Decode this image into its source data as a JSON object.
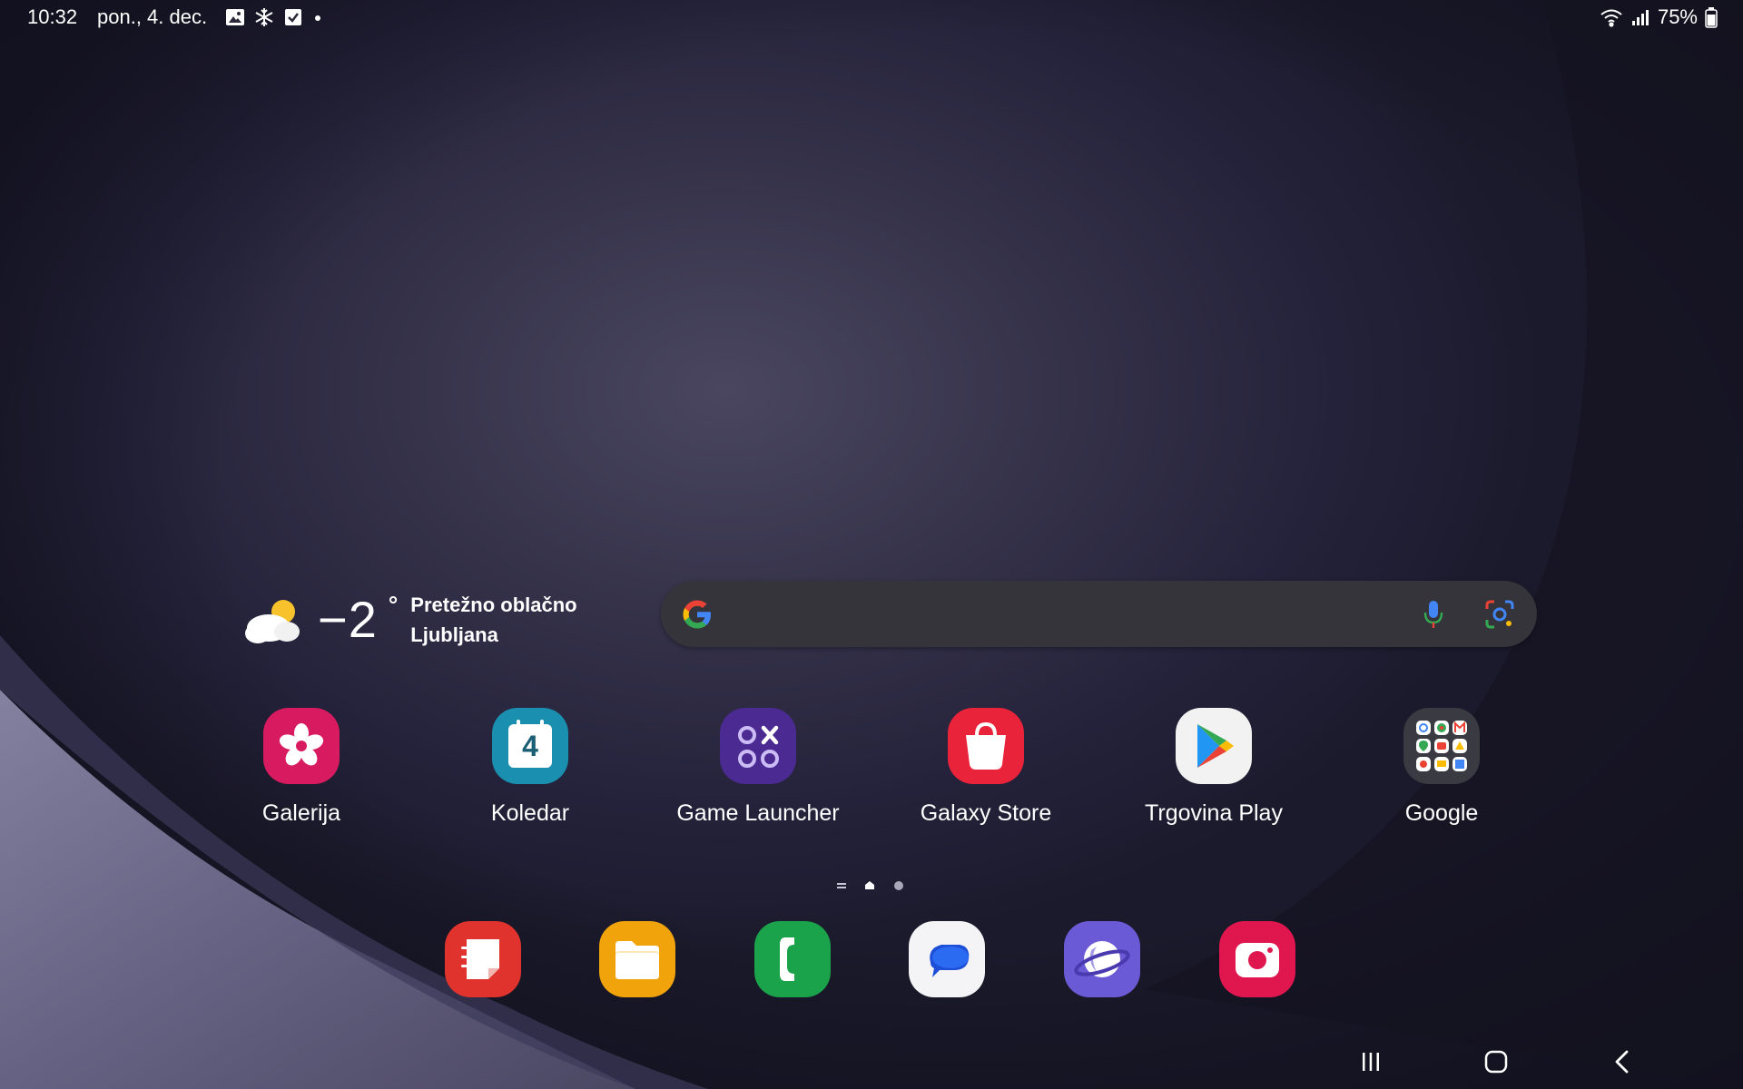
{
  "status_bar": {
    "time": "10:32",
    "date": "pon., 4. dec.",
    "notification_icons": [
      "gallery-icon",
      "snowflake-icon",
      "checkbox-icon",
      "dot-icon"
    ],
    "battery_percent": "75%",
    "icons_right": [
      "wifi-icon",
      "signal-icon",
      "battery-icon"
    ]
  },
  "weather": {
    "temperature": "−2",
    "unit": "°",
    "condition": "Pretežno oblačno",
    "location": "Ljubljana",
    "icon": "partly-cloudy-icon"
  },
  "search_bar": {
    "icons": [
      "google-g-icon",
      "microphone-icon",
      "google-lens-icon"
    ]
  },
  "apps": [
    {
      "label": "Galerija",
      "icon": "gallery-flower-icon",
      "color": "#d81b60"
    },
    {
      "label": "Koledar",
      "icon": "calendar-icon",
      "color": "#1a8fb0",
      "calendar_day": "4"
    },
    {
      "label": "Game Launcher",
      "icon": "game-launcher-icon",
      "color": "#4b2a91"
    },
    {
      "label": "Galaxy Store",
      "icon": "shopping-bag-icon",
      "color": "#e8233a"
    },
    {
      "label": "Trgovina Play",
      "icon": "google-play-icon",
      "color": "#f2f2f2"
    },
    {
      "label": "Google",
      "icon": "google-folder-icon",
      "color": "#3a3a42"
    }
  ],
  "page_indicator": {
    "pages": 3,
    "current": 1
  },
  "dock": [
    {
      "name": "notes",
      "icon": "samsung-notes-icon",
      "color": "#e0332d"
    },
    {
      "name": "files",
      "icon": "folder-icon",
      "color": "#f0a30a"
    },
    {
      "name": "phone",
      "icon": "phone-icon",
      "color": "#1aa34a"
    },
    {
      "name": "messages",
      "icon": "messages-icon",
      "color": "#f4f4f6"
    },
    {
      "name": "internet",
      "icon": "samsung-internet-icon",
      "color": "#6a5ad6"
    },
    {
      "name": "camera",
      "icon": "camera-icon",
      "color": "#e0174f"
    }
  ],
  "nav_bar": [
    "recents-icon",
    "home-icon",
    "back-icon"
  ]
}
